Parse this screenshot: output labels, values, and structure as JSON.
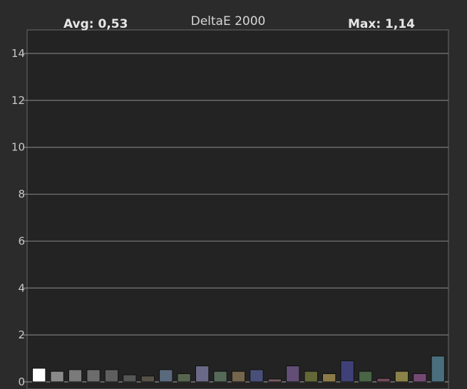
{
  "chart_data": {
    "type": "bar",
    "title": "DeltaE 2000",
    "avg_label": "Avg: 0,53",
    "max_label": "Max: 1,14",
    "xlabel": "",
    "ylabel": "",
    "ylim": [
      0,
      15
    ],
    "yticks": [
      0,
      2,
      4,
      6,
      8,
      10,
      12,
      14
    ],
    "grid": true,
    "values": [
      0.58,
      0.45,
      0.52,
      0.52,
      0.52,
      0.3,
      0.25,
      0.52,
      0.35,
      0.68,
      0.45,
      0.45,
      0.52,
      0.12,
      0.68,
      0.45,
      0.35,
      0.9,
      0.45,
      0.15,
      0.45,
      0.35,
      1.1
    ],
    "colors": [
      "#ffffff",
      "#8a8a8a",
      "#7a7a7a",
      "#6c6c6c",
      "#5e5e5e",
      "#555555",
      "#575148",
      "#5a6a7c",
      "#58654e",
      "#6a6a88",
      "#566a5a",
      "#74654c",
      "#48507a",
      "#7a5c64",
      "#624e76",
      "#646838",
      "#8c7a48",
      "#404078",
      "#4a6446",
      "#744a5a",
      "#8a8248",
      "#744a74",
      "#4a6e7e"
    ]
  }
}
